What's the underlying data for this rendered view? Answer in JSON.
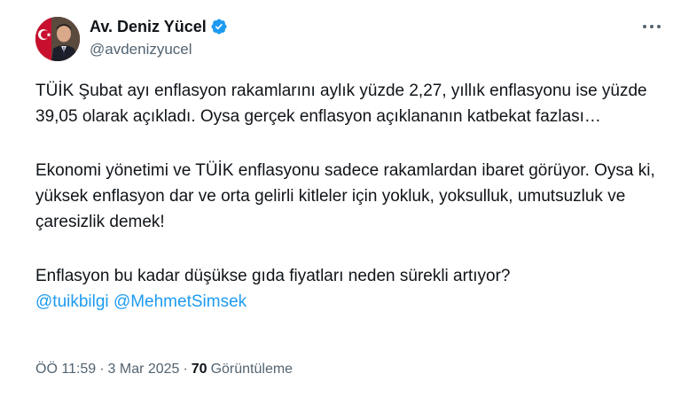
{
  "author": {
    "name": "Av. Deniz Yücel",
    "handle": "@avdenizyucel",
    "verified_color": "#1d9bf0"
  },
  "tweet": {
    "paragraph1": "TÜİK Şubat ayı enflasyon rakamlarını aylık yüzde 2,27, yıllık enflasyonu ise yüzde 39,05 olarak açıkladı. Oysa gerçek enflasyon açıklananın katbekat fazlası…",
    "paragraph2": "Ekonomi yönetimi ve TÜİK enflasyonu sadece rakamlardan ibaret görüyor. Oysa ki, yüksek enflasyon dar ve orta gelirli kitleler için yokluk, yoksulluk, umutsuzluk ve çaresizlik demek!",
    "paragraph3": "Enflasyon bu kadar düşükse gıda fiyatları neden sürekli artıyor?",
    "mentions": [
      "@tuikbilgi",
      "@MehmetSimsek"
    ]
  },
  "meta": {
    "time": "ÖÖ 11:59",
    "separator": "·",
    "date": "3 Mar 2025",
    "views_count": "70",
    "views_label": "Görüntüleme"
  },
  "icons": {
    "more": "more-horizontal-icon",
    "verified": "verified-badge-icon"
  },
  "colors": {
    "text": "#0f1419",
    "secondary": "#536471",
    "link": "#1d9bf0"
  }
}
